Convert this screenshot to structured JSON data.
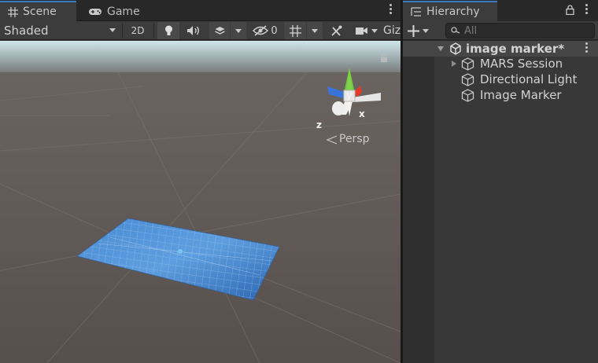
{
  "scene_tabs": {
    "scene_label": "Scene",
    "game_label": "Game"
  },
  "scene_toolbar": {
    "shading_mode": "Shaded",
    "mode_2d_label": "2D",
    "hidden_count": "0",
    "gizmos_label": "Giz"
  },
  "viewport": {
    "projection_label": "Persp",
    "axis_x": "x",
    "axis_y": "y",
    "axis_z": "z",
    "background_sky": "#cfe6ea",
    "ground_color": "#5d5753",
    "marker_color": "#3f7fcb"
  },
  "hierarchy": {
    "tab_label": "Hierarchy",
    "search_placeholder": "All",
    "root_label": "image marker*",
    "items": [
      {
        "label": "MARS Session",
        "expandable": true
      },
      {
        "label": "Directional Light",
        "expandable": false
      },
      {
        "label": "Image Marker",
        "expandable": false
      }
    ]
  },
  "icons": {
    "scene_tab": "grid-icon",
    "game_tab": "gamepad-icon",
    "hierarchy_tab": "list-icon",
    "lock": "lock-icon",
    "add": "plus-icon",
    "search": "search-icon",
    "root": "unity-scene-icon",
    "gameobject": "cube-icon",
    "light": "lightbulb-icon",
    "audio": "speaker-icon",
    "effects": "layers-icon",
    "visibility": "eye-slash-icon",
    "grid": "grid-snap-icon",
    "tools": "tools-icon",
    "camera": "camera-icon"
  }
}
